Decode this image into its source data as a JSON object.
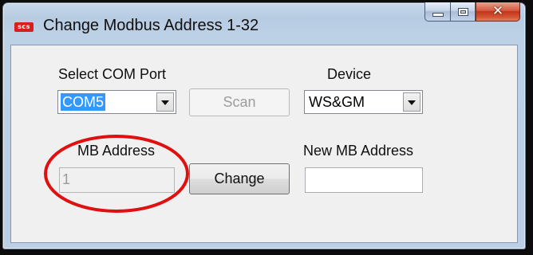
{
  "window": {
    "title": "Change Modbus Address 1-32",
    "icon_text": "scs",
    "icon_color": "#d91e1e",
    "caption_buttons": [
      "minimize",
      "maximize",
      "close"
    ]
  },
  "form": {
    "com_port": {
      "label": "Select COM Port",
      "value": "COM5"
    },
    "scan_button": {
      "label": "Scan",
      "enabled": false
    },
    "device": {
      "label": "Device",
      "value": "WS&GM"
    },
    "mb_address": {
      "label": "MB Address",
      "value": "1"
    },
    "change_button": {
      "label": "Change"
    },
    "new_mb_address": {
      "label": "New MB Address",
      "value": ""
    }
  },
  "annotation": {
    "shape": "ellipse",
    "color": "#e01010"
  },
  "colors": {
    "selection": "#3399ff",
    "window_frame": "#bcd0e6",
    "close_button": "#c2341b"
  }
}
